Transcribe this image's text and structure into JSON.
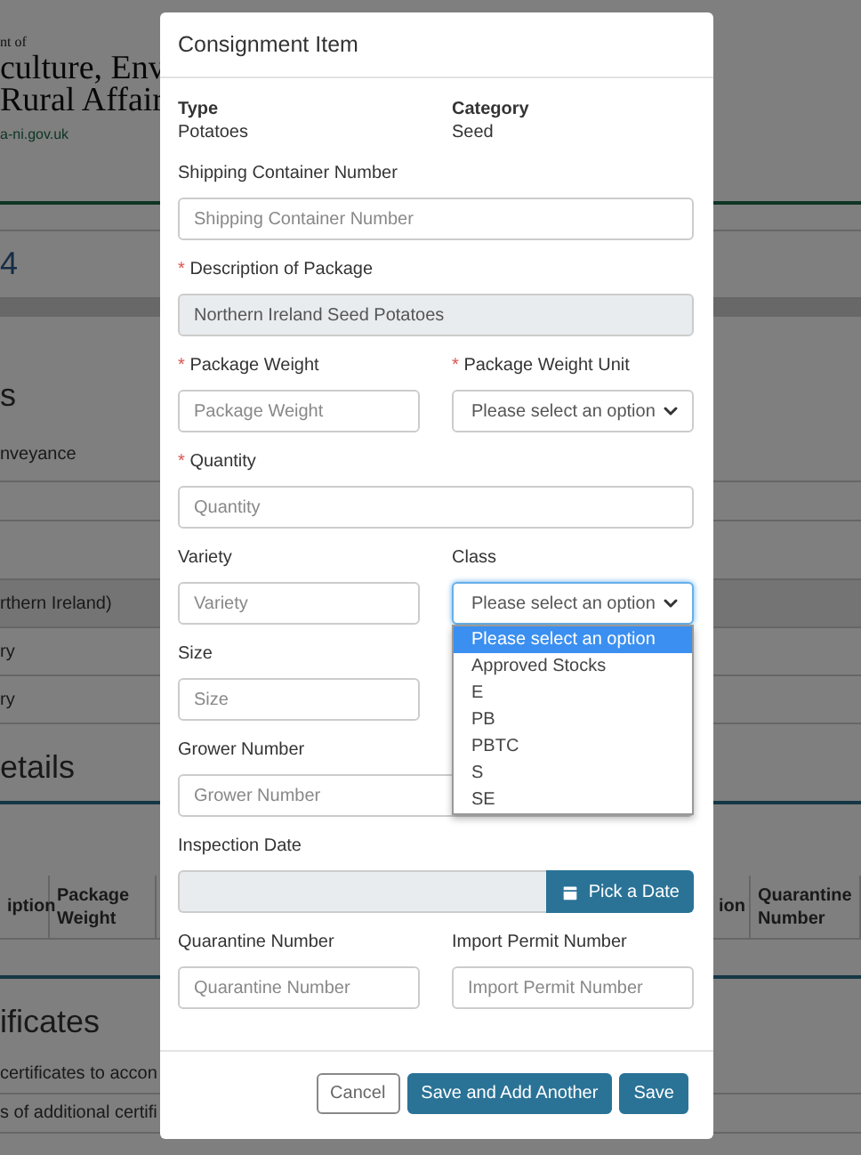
{
  "background": {
    "header": {
      "line_1": "nt of",
      "line_2": "culture, Env",
      "line_3": "Rural Affair",
      "link": "a-ni.gov.uk"
    },
    "step": "4",
    "section_heading": "s",
    "rows": [
      {
        "text": "nveyance",
        "shaded": false
      },
      {
        "text": "rthern Ireland)",
        "shaded": true
      },
      {
        "text": "ry",
        "shaded": false
      },
      {
        "text": "ry",
        "shaded": false
      }
    ],
    "details_heading": "etails",
    "table": {
      "left_columns": [
        "iption",
        "Package Weight"
      ],
      "right_columns": [
        "ion",
        "Quarantine Number"
      ]
    },
    "certificates_heading": "ificates",
    "certificates_lines": [
      "certificates to accon",
      "s of additional certifi"
    ]
  },
  "modal": {
    "title": "Consignment Item",
    "summary": [
      {
        "label": "Type",
        "value": "Potatoes"
      },
      {
        "label": "Category",
        "value": "Seed"
      }
    ],
    "rows": [
      [
        {
          "kind": "text",
          "label": "Shipping Container Number",
          "placeholder": "Shipping Container Number"
        }
      ],
      [
        {
          "kind": "readonly",
          "required_marker": "*",
          "label": "Description of Package",
          "value": "Northern Ireland Seed Potatoes"
        }
      ],
      [
        {
          "kind": "text",
          "required_marker": "*",
          "label": "Package Weight",
          "placeholder": "Package Weight"
        },
        {
          "kind": "select",
          "required_marker": "*",
          "label": "Package Weight Unit",
          "value": "Please select an option",
          "expanded": false
        }
      ],
      [
        {
          "kind": "text",
          "required_marker": "*",
          "label": "Quantity",
          "placeholder": "Quantity"
        }
      ],
      [
        {
          "kind": "text",
          "label": "Variety",
          "placeholder": "Variety"
        },
        {
          "kind": "select",
          "label": "Class",
          "value": "Please select an option",
          "expanded": true,
          "options": [
            {
              "label": "Please select an option",
              "selected": true
            },
            {
              "label": "Approved Stocks",
              "selected": false
            },
            {
              "label": "E",
              "selected": false
            },
            {
              "label": "PB",
              "selected": false
            },
            {
              "label": "PBTC",
              "selected": false
            },
            {
              "label": "S",
              "selected": false
            },
            {
              "label": "SE",
              "selected": false
            }
          ]
        }
      ],
      [
        {
          "kind": "text",
          "label": "Size",
          "placeholder": "Size",
          "half": true
        }
      ],
      [
        {
          "kind": "text",
          "label": "Grower Number",
          "placeholder": "Grower Number"
        }
      ],
      [
        {
          "kind": "date",
          "label": "Inspection Date",
          "button": "Pick a Date"
        }
      ],
      [
        {
          "kind": "text",
          "label": "Quarantine Number",
          "placeholder": "Quarantine Number"
        },
        {
          "kind": "text",
          "label": "Import Permit Number",
          "placeholder": "Import Permit Number"
        }
      ]
    ],
    "buttons": [
      {
        "label": "Cancel",
        "kind": "secondary"
      },
      {
        "label": "Save and Add Another",
        "kind": "primary"
      },
      {
        "label": "Save",
        "kind": "primary"
      }
    ]
  }
}
